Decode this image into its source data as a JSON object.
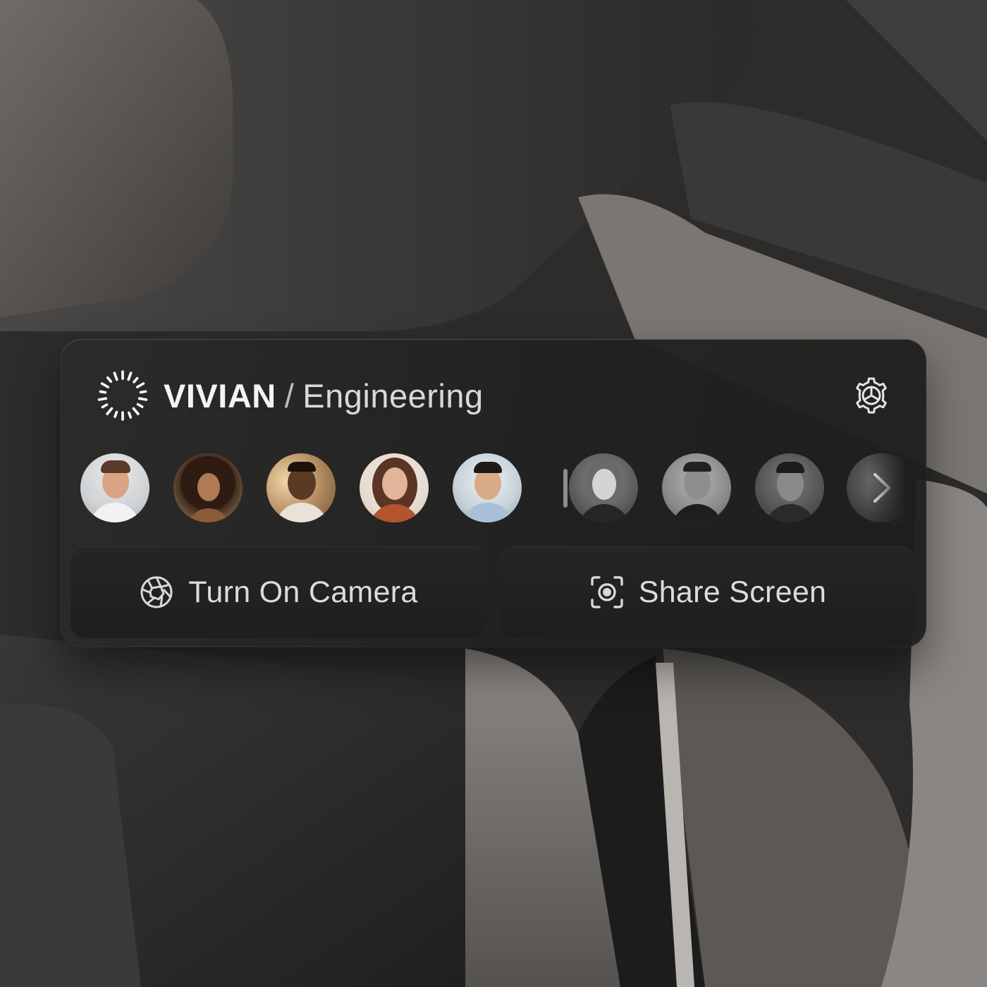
{
  "app": {
    "company": "VIVIAN",
    "separator": "/",
    "team": "Engineering"
  },
  "icons": {
    "logo": "sunburst-logo",
    "settings": "gear-icon",
    "camera": "aperture-icon",
    "share": "screen-capture-icon",
    "next": "chevron-right-icon"
  },
  "participants": {
    "active_count": 5,
    "muted_count": 4,
    "divider": true,
    "next_label": "next participants"
  },
  "actions": {
    "camera_label": "Turn On Camera",
    "share_label": "Share Screen"
  },
  "colors": {
    "panel": "#2a2929",
    "button": "#232222",
    "text": "#f4f4f4"
  }
}
